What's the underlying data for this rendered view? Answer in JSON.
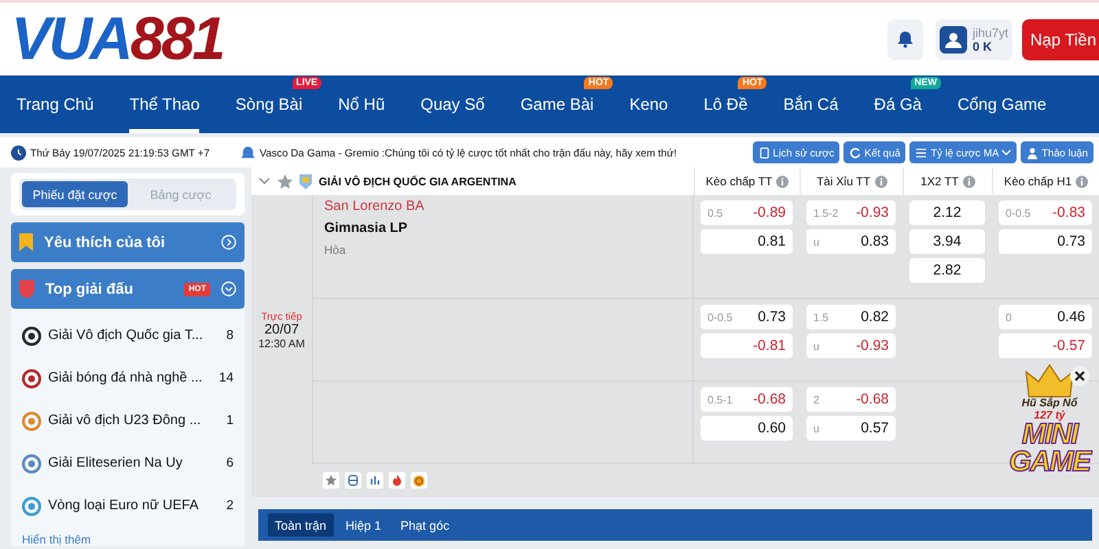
{
  "header": {
    "logo": {
      "word": "VUA",
      "number": "881"
    },
    "user": {
      "name": "jihu7yt",
      "balance": "0 K"
    },
    "deposit_button": "Nạp Tiền"
  },
  "nav": [
    {
      "label": "Trang Chủ",
      "selected": false
    },
    {
      "label": "Thể Thao",
      "selected": true
    },
    {
      "label": "Sòng Bài",
      "selected": false,
      "badge": {
        "text": "LIVE",
        "color": "#e8193c"
      }
    },
    {
      "label": "Nổ Hũ",
      "selected": false
    },
    {
      "label": "Quay Số",
      "selected": false
    },
    {
      "label": "Game Bài",
      "selected": false,
      "badge": {
        "text": "HOT",
        "color": "#f47a1f"
      }
    },
    {
      "label": "Keno",
      "selected": false
    },
    {
      "label": "Lô Đề",
      "selected": false,
      "badge": {
        "text": "HOT",
        "color": "#f47a1f"
      }
    },
    {
      "label": "Bắn Cá",
      "selected": false
    },
    {
      "label": "Đá Gà",
      "selected": false,
      "badge": {
        "text": "NEW",
        "color": "#12a89a"
      }
    },
    {
      "label": "Cổng Game",
      "selected": false
    }
  ],
  "info_bar": {
    "datetime": "Thứ Bảy 19/07/2025 21:19:53 GMT +7",
    "ticker": "Vasco Da Gama - Gremio :Chúng tôi có tỷ lệ cược tốt nhất cho trận đấu này, hãy xem thứ!",
    "buttons": [
      {
        "label": "Lịch sử cược",
        "kind": "history"
      },
      {
        "label": "Kết quả",
        "kind": "results"
      },
      {
        "label": "Tỷ lệ cược MA",
        "kind": "odds"
      },
      {
        "label": "Thảo luận",
        "kind": "chat"
      }
    ]
  },
  "sidebar": {
    "tabs": [
      {
        "label": "Phiếu đặt cược",
        "selected": true
      },
      {
        "label": "Bảng cược",
        "selected": false
      }
    ],
    "favorites": "Yêu thích của tôi",
    "top": {
      "title": "Top giải đấu",
      "badge": "HOT",
      "expanded": true
    },
    "leagues": [
      {
        "name": "Giải Vô địch Quốc gia T...",
        "count": "8"
      },
      {
        "name": "Giải bóng đá nhà nghề ...",
        "count": "14"
      },
      {
        "name": "Giải vô địch U23 Đông ...",
        "count": "1"
      },
      {
        "name": "Giải Eliteserien Na Uy",
        "count": "6"
      },
      {
        "name": "Vòng loại Euro nữ UEFA",
        "count": "2"
      }
    ],
    "more": "Hiển thị thêm"
  },
  "league": {
    "title": "GIẢI VÔ ĐỊCH QUỐC GIA ARGENTINA",
    "columns": [
      "Kèo chấp TT",
      "Tài Xỉu TT",
      "1X2 TT",
      "Kèo chấp H1"
    ]
  },
  "match": {
    "status": "Trực tiếp",
    "date": "20/07",
    "time": "12:30 AM",
    "teams": [
      {
        "name": "San Lorenzo BA",
        "highlighted": true
      },
      {
        "name": "Gimnasia LP",
        "highlighted": false
      }
    ],
    "draw": "Hòa",
    "odds_rows": [
      [
        [
          {
            "line": "0.5",
            "odds": "-0.89",
            "negative": true
          },
          {
            "odds": "0.81",
            "negative": false
          }
        ],
        [
          {
            "line": "1.5-2",
            "odds": "-0.93",
            "negative": true
          },
          {
            "line": "u",
            "odds": "0.83",
            "negative": false
          }
        ],
        [
          {
            "odds": "2.12",
            "negative": false
          },
          {
            "odds": "3.94",
            "negative": false
          },
          {
            "odds": "2.82",
            "negative": false
          }
        ],
        [
          {
            "line": "0-0.5",
            "odds": "-0.83",
            "negative": true
          },
          {
            "odds": "0.73",
            "negative": false
          }
        ]
      ],
      [
        [
          {
            "line": "0-0.5",
            "odds": "0.73",
            "negative": false
          },
          {
            "odds": "-0.81",
            "negative": true
          }
        ],
        [
          {
            "line": "1.5",
            "odds": "0.82",
            "negative": false
          },
          {
            "line": "u",
            "odds": "-0.93",
            "negative": true
          }
        ],
        [],
        [
          {
            "line": "0",
            "odds": "0.46",
            "negative": false
          },
          {
            "odds": "-0.57",
            "negative": true
          }
        ]
      ],
      [
        [
          {
            "line": "0.5-1",
            "odds": "-0.68",
            "negative": true
          },
          {
            "odds": "0.60",
            "negative": false
          }
        ],
        [
          {
            "line": "2",
            "odds": "-0.68",
            "negative": true
          },
          {
            "line": "u",
            "odds": "0.57",
            "negative": false
          }
        ],
        [],
        []
      ]
    ]
  },
  "period_tabs": [
    {
      "label": "Toàn trận",
      "selected": true
    },
    {
      "label": "Hiệp 1",
      "selected": false
    },
    {
      "label": "Phạt góc",
      "selected": false
    }
  ],
  "mini_game": {
    "title": "Hũ Sắp Nổ",
    "amount": "127 tỷ",
    "word_top": "MINI",
    "word_bottom": "GAME"
  }
}
